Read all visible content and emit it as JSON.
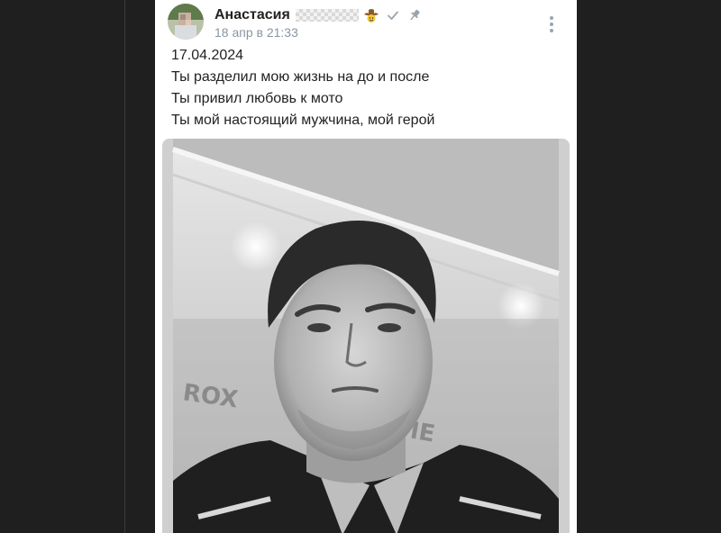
{
  "post": {
    "author_name": "Анастасия",
    "timestamp": "18 апр в 21:33",
    "icons": {
      "sticker": "cowboy-emoji-icon",
      "verified": "checkmark-icon",
      "pin": "pin-icon",
      "more": "more-vertical-icon"
    },
    "text_lines": [
      "17.04.2024",
      "Ты разделил мою жизнь на до и после",
      "Ты привил любовь к мото",
      "Ты мой настоящий мужчина, мой герой"
    ],
    "photo": "black-and-white selfie photo"
  },
  "colors": {
    "background": "#1f1f1f",
    "card": "#ffffff",
    "timestamp": "#8a96a3",
    "text": "#222222"
  }
}
